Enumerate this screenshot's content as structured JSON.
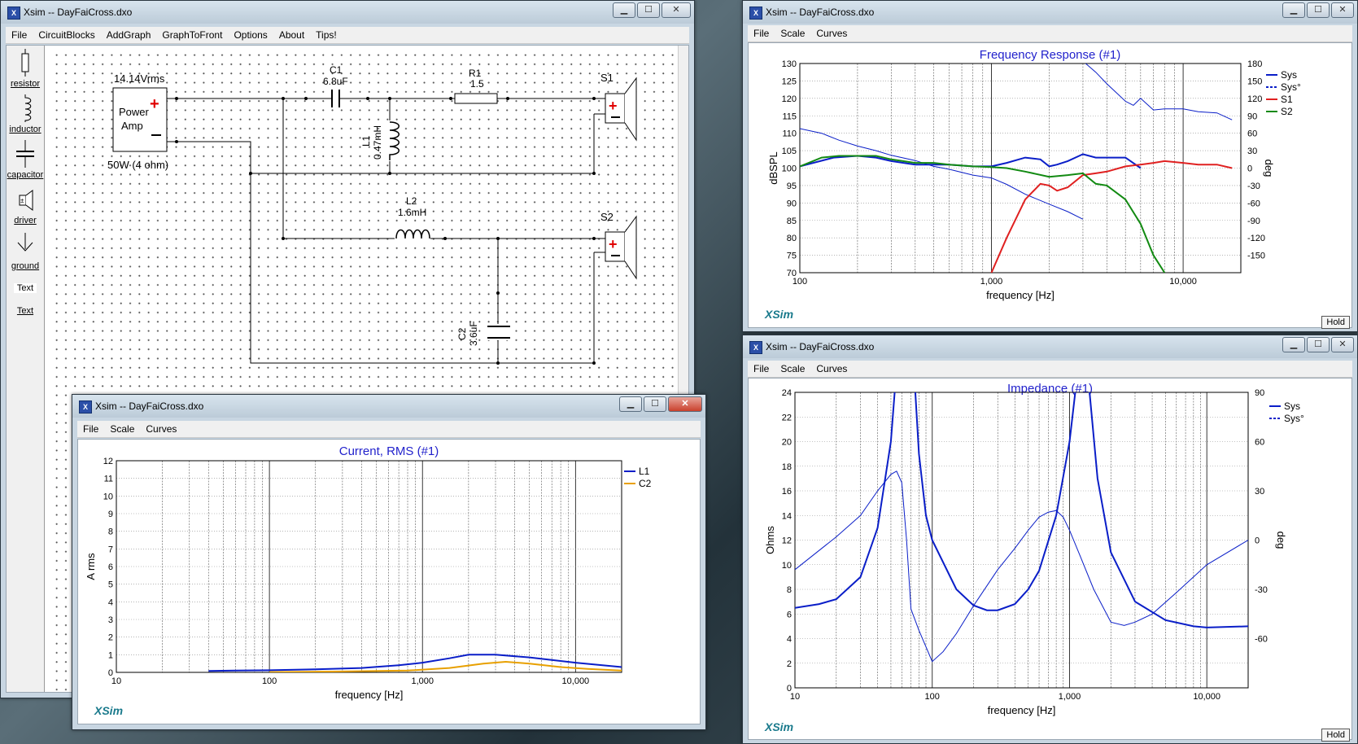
{
  "main": {
    "title": "Xsim -- DayFaiCross.dxo",
    "menu": [
      "File",
      "CircuitBlocks",
      "AddGraph",
      "GraphToFront",
      "Options",
      "About",
      "Tips!"
    ],
    "palette": [
      "resistor",
      "inductor",
      "capacitor",
      "driver",
      "ground",
      "Text",
      "Text"
    ],
    "schematic": {
      "amp_voltage": "14.14Vrms",
      "amp_label1": "Power",
      "amp_label2": "Amp",
      "amp_rating": "50W (4 ohm)",
      "c1_name": "C1",
      "c1_value": "6.8uF",
      "r1_name": "R1",
      "r1_value": "1.5",
      "l1_name": "L1",
      "l1_value": "0.47mH",
      "l2_name": "L2",
      "l2_value": "1.6mH",
      "c2_name": "C2",
      "c2_value": "3.6uF",
      "s1_name": "S1",
      "s2_name": "S2"
    }
  },
  "freq_window": {
    "title": "Xsim -- DayFaiCross.dxo",
    "menu": [
      "File",
      "Scale",
      "Curves"
    ],
    "xsim": "XSim",
    "hold": "Hold",
    "chart_data": {
      "type": "line",
      "title": "Frequency Response (#1)",
      "xlabel": "frequency [Hz]",
      "ylabel": "dBSPL",
      "y2label": "deg",
      "x_scale": "log",
      "xlim": [
        100,
        20000
      ],
      "ylim": [
        70,
        130
      ],
      "y2lim": [
        -180,
        180
      ],
      "x_ticks": [
        "100",
        "1,000",
        "10,000"
      ],
      "y_ticks": [
        "70",
        "75",
        "80",
        "85",
        "90",
        "95",
        "100",
        "105",
        "110",
        "115",
        "120",
        "125",
        "130"
      ],
      "y2_ticks": [
        "-150",
        "-120",
        "-90",
        "-60",
        "-30",
        "0",
        "30",
        "60",
        "90",
        "120",
        "150",
        "180"
      ],
      "grid": true,
      "legend_position": "top-right",
      "series": [
        {
          "name": "Sys",
          "color": "#0a1ec8",
          "style": "solid",
          "axis": "y",
          "x": [
            100,
            150,
            200,
            250,
            300,
            400,
            500,
            600,
            800,
            1000,
            1200,
            1500,
            1800,
            2000,
            2200,
            2500,
            3000,
            3500,
            4000,
            5000,
            6000
          ],
          "y": [
            100.5,
            103,
            103.5,
            103,
            102,
            101,
            101,
            101,
            100.5,
            100.5,
            101.5,
            103,
            102.5,
            100.5,
            101,
            102,
            104,
            103,
            103,
            103,
            100
          ]
        },
        {
          "name": "Sys°",
          "color": "#0a1ec8",
          "style": "dashed",
          "axis": "y2",
          "x": [
            100,
            130,
            160,
            200,
            250,
            300,
            400,
            500,
            600,
            800,
            1000,
            1200,
            1500,
            2000,
            2500,
            3000,
            3100,
            3500,
            4000,
            5000,
            5500,
            6000,
            7000,
            8000,
            10000,
            12000,
            15000,
            18000
          ],
          "y": [
            68,
            60,
            48,
            38,
            30,
            22,
            13,
            3,
            -2,
            -12,
            -17,
            -28,
            -45,
            -62,
            -75,
            -88,
            180,
            165,
            145,
            115,
            108,
            120,
            100,
            102,
            102,
            97,
            95,
            83
          ]
        },
        {
          "name": "S1",
          "color": "#e02020",
          "style": "solid",
          "axis": "y",
          "x": [
            1000,
            1200,
            1500,
            1800,
            2000,
            2200,
            2500,
            3000,
            3500,
            4000,
            5000,
            6000,
            7000,
            8000,
            10000,
            12000,
            15000,
            18000
          ],
          "y": [
            70,
            80,
            91,
            95.5,
            95,
            93.5,
            94.5,
            98,
            98.5,
            99,
            100.5,
            101,
            101.5,
            102,
            101.5,
            101,
            101,
            100
          ]
        },
        {
          "name": "S2",
          "color": "#128a12",
          "style": "solid",
          "axis": "y",
          "x": [
            100,
            130,
            160,
            200,
            250,
            300,
            400,
            500,
            600,
            800,
            1000,
            1200,
            1500,
            2000,
            2500,
            3000,
            3500,
            4000,
            5000,
            6000,
            7000,
            8000
          ],
          "y": [
            100.5,
            103,
            103.5,
            103.5,
            103.5,
            102.5,
            101.5,
            101.5,
            101,
            100.5,
            100.3,
            100,
            99,
            97.5,
            98,
            98.5,
            95.5,
            95,
            91,
            84,
            75,
            70
          ]
        }
      ]
    }
  },
  "imp_window": {
    "title": "Xsim -- DayFaiCross.dxo",
    "menu": [
      "File",
      "Scale",
      "Curves"
    ],
    "xsim": "XSim",
    "hold": "Hold",
    "chart_data": {
      "type": "line",
      "title": "Impedance (#1)",
      "xlabel": "frequency [Hz]",
      "ylabel": "Ohms",
      "y2label": "deg",
      "x_scale": "log",
      "xlim": [
        10,
        20000
      ],
      "ylim": [
        0,
        24
      ],
      "y2lim": [
        -90,
        90
      ],
      "x_ticks": [
        "10",
        "100",
        "1,000",
        "10,000"
      ],
      "y_ticks": [
        "0",
        "2",
        "4",
        "6",
        "8",
        "10",
        "12",
        "14",
        "16",
        "18",
        "20",
        "22",
        "24"
      ],
      "y2_ticks": [
        "-60",
        "-30",
        "0",
        "30",
        "60",
        "90"
      ],
      "grid": true,
      "legend_position": "top-right",
      "series": [
        {
          "name": "Sys",
          "color": "#0a1ec8",
          "style": "solid",
          "axis": "y",
          "x": [
            10,
            15,
            20,
            30,
            40,
            50,
            55,
            60,
            70,
            80,
            90,
            100,
            150,
            200,
            250,
            300,
            400,
            500,
            600,
            800,
            1000,
            1100,
            1200,
            1300,
            1400,
            1600,
            2000,
            3000,
            5000,
            8000,
            10000,
            20000
          ],
          "y": [
            6.5,
            6.8,
            7.2,
            9,
            13,
            20,
            26,
            40,
            30,
            19,
            14,
            12,
            8,
            6.7,
            6.3,
            6.3,
            6.8,
            8,
            9.5,
            14,
            20,
            24,
            30,
            30,
            24,
            17,
            11,
            7,
            5.5,
            5,
            4.9,
            5
          ]
        },
        {
          "name": "Sys°",
          "color": "#0a1ec8",
          "style": "dashed",
          "axis": "y2",
          "x": [
            10,
            20,
            30,
            40,
            50,
            55,
            60,
            65,
            70,
            80,
            90,
            100,
            120,
            150,
            200,
            300,
            400,
            500,
            600,
            700,
            800,
            900,
            1000,
            1200,
            1500,
            2000,
            2500,
            3000,
            4000,
            6000,
            10000,
            20000
          ],
          "y": [
            -18,
            2,
            15,
            30,
            40,
            42,
            35,
            0,
            -42,
            -55,
            -65,
            -74,
            -68,
            -57,
            -40,
            -18,
            -5,
            6,
            14,
            17,
            18,
            14,
            6,
            -10,
            -30,
            -50,
            -52,
            -50,
            -45,
            -32,
            -15,
            0
          ]
        }
      ]
    }
  },
  "cur_window": {
    "title": "Xsim -- DayFaiCross.dxo",
    "menu": [
      "File",
      "Scale",
      "Curves"
    ],
    "xsim": "XSim",
    "chart_data": {
      "type": "line",
      "title": "Current, RMS (#1)",
      "xlabel": "frequency [Hz]",
      "ylabel": "A rms",
      "x_scale": "log",
      "xlim": [
        10,
        20000
      ],
      "ylim": [
        0,
        12
      ],
      "x_ticks": [
        "10",
        "100",
        "1,000",
        "10,000"
      ],
      "y_ticks": [
        "0",
        "1",
        "2",
        "3",
        "4",
        "5",
        "6",
        "7",
        "8",
        "9",
        "10",
        "11",
        "12"
      ],
      "grid": true,
      "legend_position": "top-right",
      "series": [
        {
          "name": "L1",
          "color": "#0a1ec8",
          "style": "solid",
          "x": [
            40,
            60,
            100,
            200,
            400,
            700,
            1000,
            1500,
            2000,
            3000,
            5000,
            10000,
            20000
          ],
          "y": [
            0.08,
            0.1,
            0.12,
            0.17,
            0.25,
            0.4,
            0.55,
            0.8,
            1.0,
            1.0,
            0.85,
            0.55,
            0.3
          ]
        },
        {
          "name": "C2",
          "color": "#e8a000",
          "style": "solid",
          "x": [
            100,
            300,
            800,
            1500,
            2500,
            3500,
            5000,
            8000,
            12000,
            20000
          ],
          "y": [
            0.02,
            0.05,
            0.1,
            0.25,
            0.5,
            0.6,
            0.5,
            0.3,
            0.2,
            0.1
          ]
        }
      ]
    }
  }
}
